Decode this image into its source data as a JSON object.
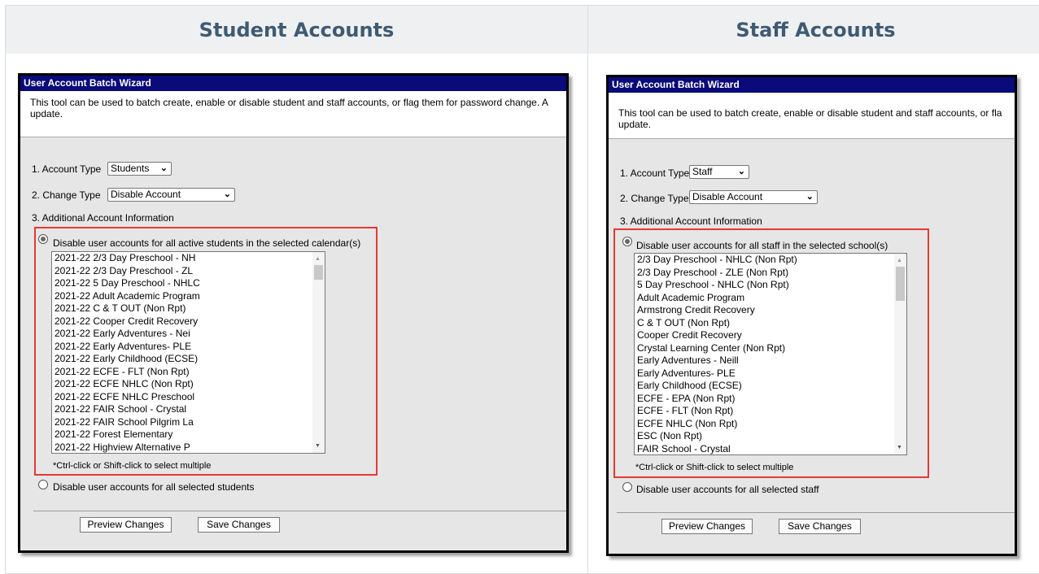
{
  "columns": [
    {
      "header": "Student Accounts"
    },
    {
      "header": "Staff Accounts"
    }
  ],
  "student": {
    "title": "User Account Batch Wizard",
    "description_line1": "This tool can be used to batch create, enable or disable student and staff accounts, or flag them for password change. A",
    "description_line2": "update.",
    "account_type_label": "1. Account Type",
    "account_type_value": "Students",
    "change_type_label": "2. Change Type",
    "change_type_value": "Disable Account",
    "additional_label": "3. Additional Account Information",
    "option1_label": "Disable user accounts for all active students in the selected calendar(s)",
    "list_items": [
      "2021-22 2/3 Day Preschool - NH",
      "2021-22 2/3 Day Preschool - ZL",
      "2021-22 5 Day Preschool - NHLC",
      "2021-22 Adult Academic Program",
      "2021-22 C & T OUT (Non Rpt)",
      "2021-22 Cooper Credit Recovery",
      "2021-22 Early Adventures - Nei",
      "2021-22 Early Adventures- PLE",
      "2021-22 Early Childhood (ECSE)",
      "2021-22 ECFE - FLT (Non Rpt)",
      "2021-22 ECFE NHLC (Non Rpt)",
      "2021-22 ECFE NHLC Preschool",
      "2021-22 FAIR School - Crystal",
      "2021-22 FAIR School Pilgrim La",
      "2021-22 Forest Elementary",
      "2021-22 Highview Alternative P"
    ],
    "hint": "*Ctrl-click or Shift-click to select multiple",
    "option2_label": "Disable user accounts for all selected students",
    "preview_label": "Preview Changes",
    "save_label": "Save Changes"
  },
  "staff": {
    "title": "User Account Batch Wizard",
    "description_line1": "This tool can be used to batch create, enable or disable student and staff accounts, or fla",
    "description_line2": "update.",
    "account_type_label": "1. Account Type",
    "account_type_value": "Staff",
    "change_type_label": "2. Change Type",
    "change_type_value": "Disable Account",
    "additional_label": "3. Additional Account Information",
    "option1_label": "Disable user accounts for all staff in the selected school(s)",
    "list_items": [
      "2/3 Day Preschool - NHLC (Non Rpt)",
      "2/3 Day Preschool - ZLE (Non Rpt)",
      "5 Day Preschool - NHLC (Non Rpt)",
      "Adult Academic Program",
      "Armstrong Credit Recovery",
      "C & T OUT (Non Rpt)",
      "Cooper Credit Recovery",
      "Crystal Learning Center (Non Rpt)",
      "Early Adventures - Neill",
      "Early Adventures- PLE",
      "Early Childhood (ECSE)",
      "ECFE - EPA (Non Rpt)",
      "ECFE - FLT (Non Rpt)",
      "ECFE NHLC (Non Rpt)",
      "ESC (Non Rpt)",
      "FAIR School - Crystal"
    ],
    "hint": "*Ctrl-click or Shift-click to select multiple",
    "option2_label": "Disable user accounts for all selected staff",
    "preview_label": "Preview Changes",
    "save_label": "Save Changes"
  },
  "icons": {
    "chevron": "chevron-down-icon",
    "scroll_up": "triangle-up",
    "scroll_down": "triangle-down"
  },
  "colors": {
    "title_bar": "#0a0a7a",
    "highlight_border": "#e53935",
    "header_text": "#3f5a73",
    "panel_bg": "#e6e6e6"
  }
}
